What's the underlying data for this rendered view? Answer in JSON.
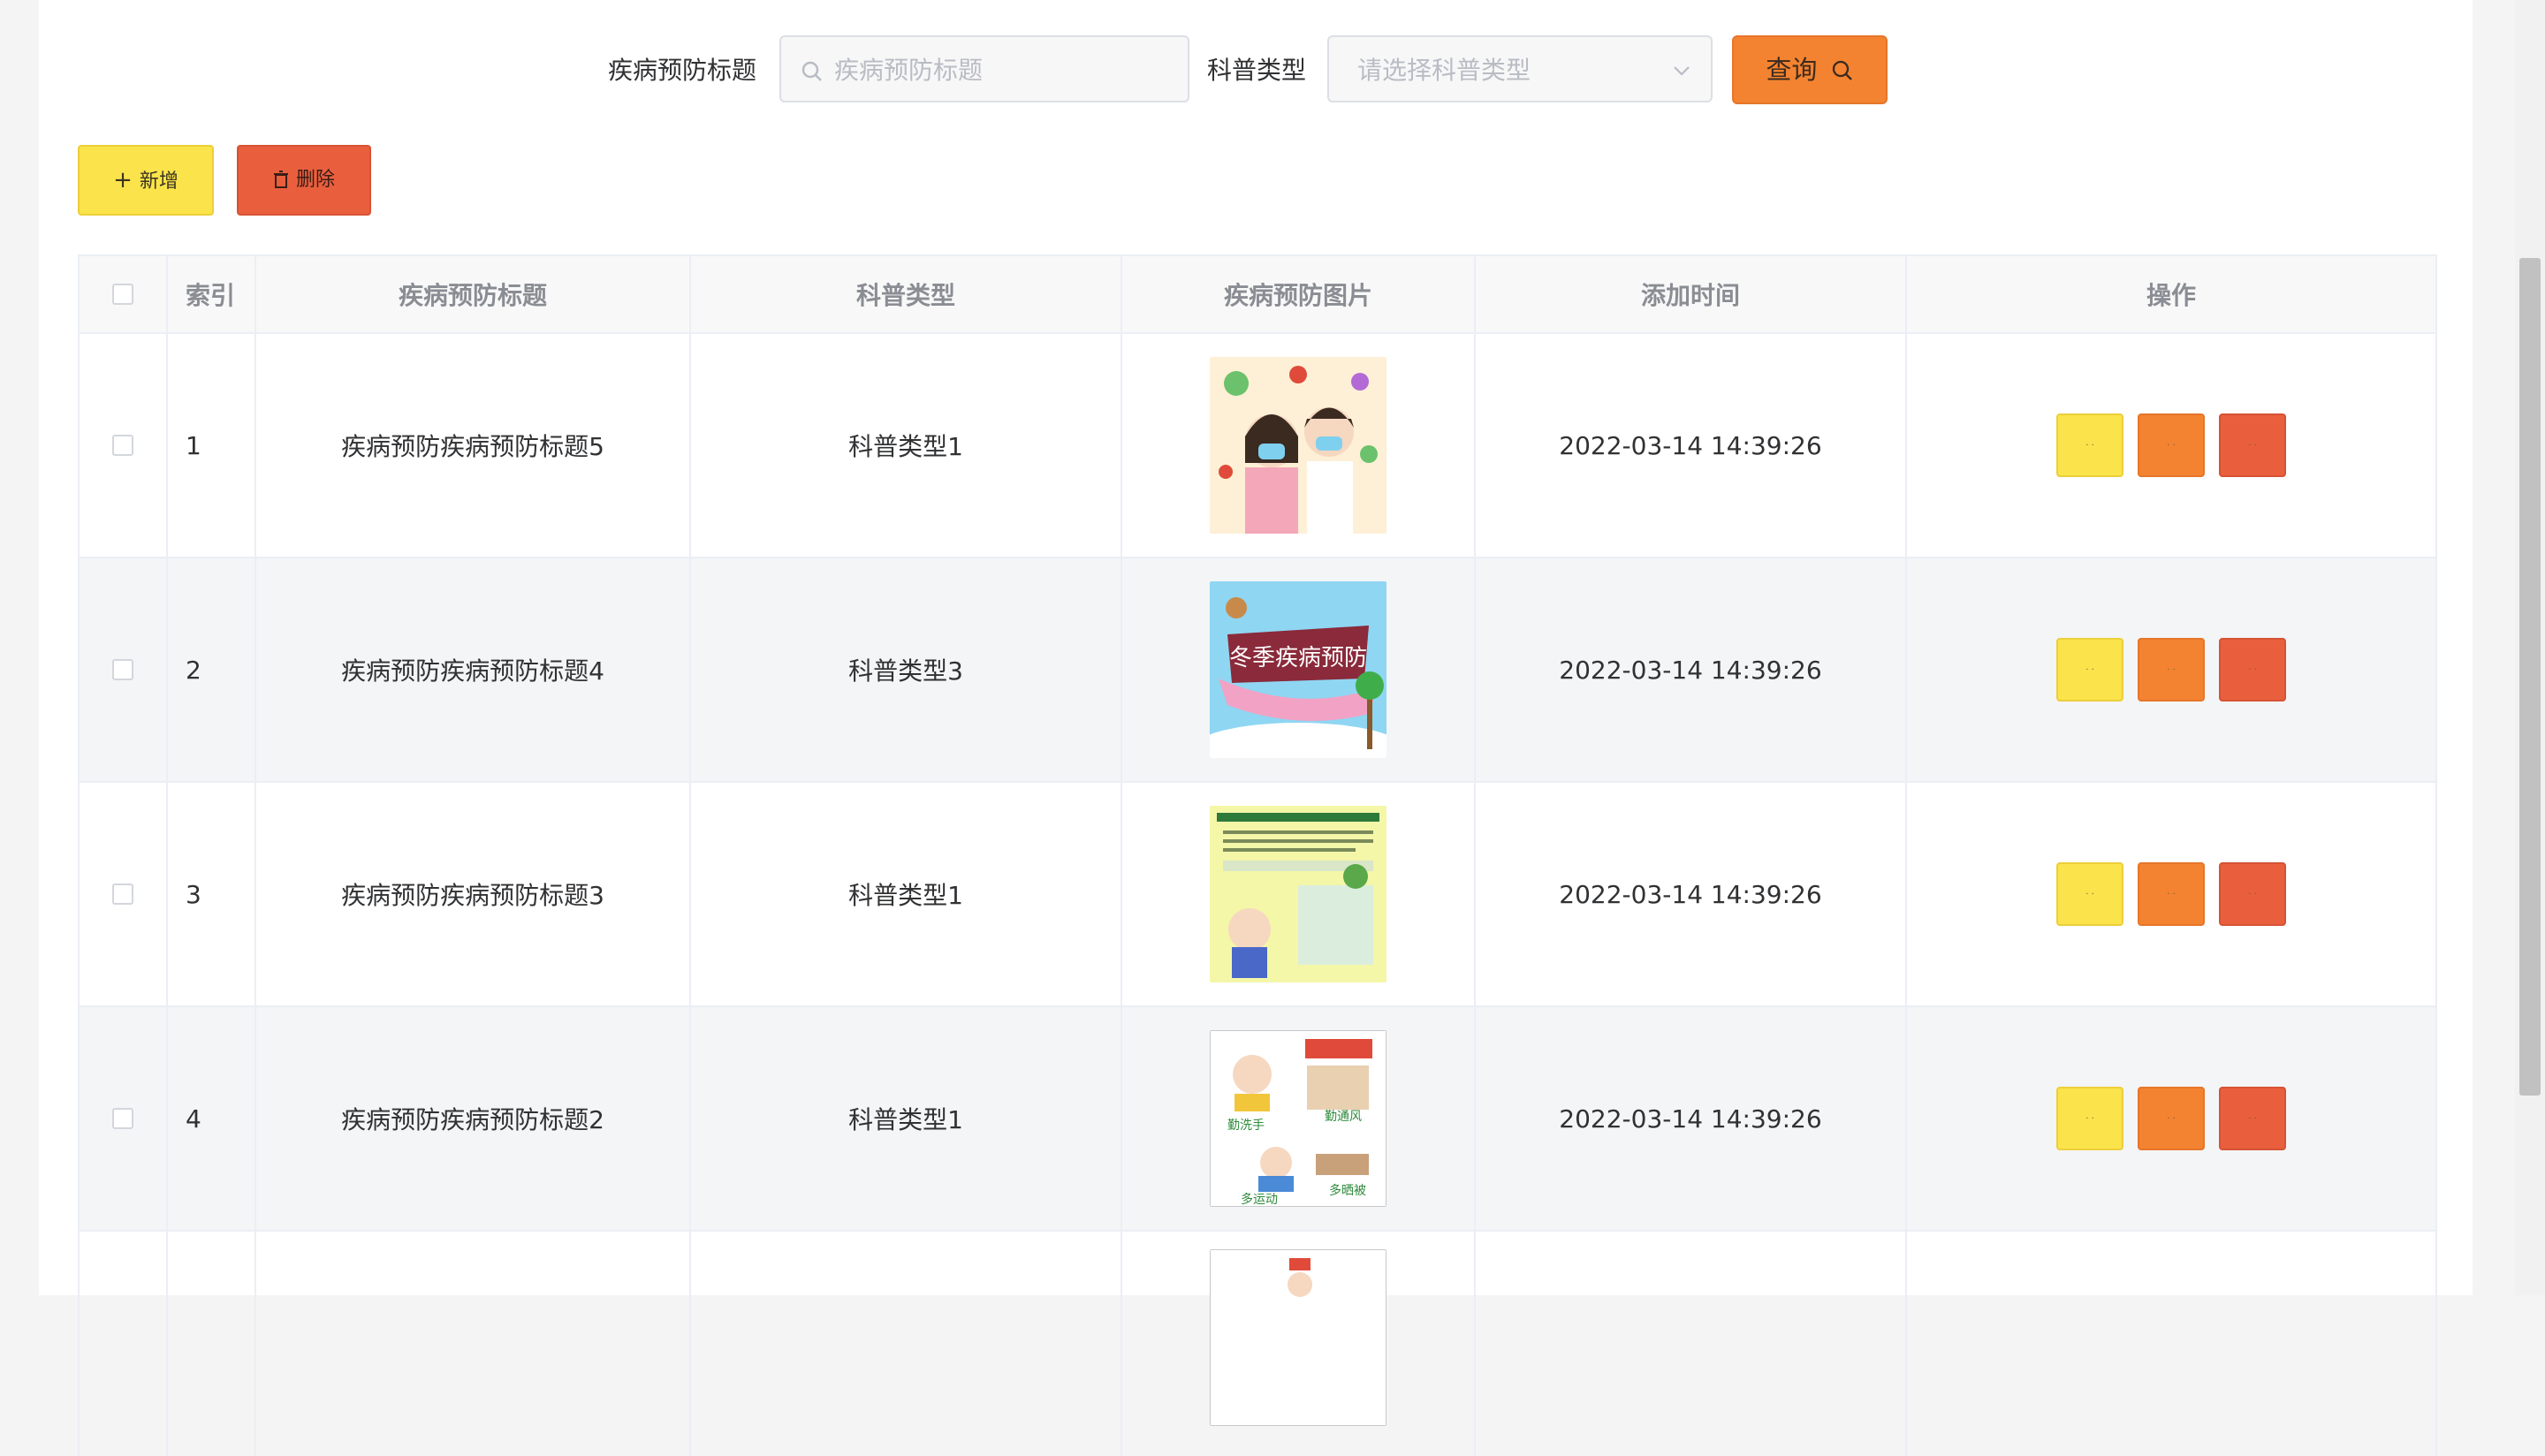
{
  "search": {
    "title_label": "疾病预防标题",
    "title_placeholder": "疾病预防标题",
    "type_label": "科普类型",
    "type_placeholder": "请选择科普类型",
    "query_label": "查询"
  },
  "toolbar": {
    "add_label": "新增",
    "delete_label": "删除"
  },
  "table": {
    "headers": [
      "索引",
      "疾病预防标题",
      "科普类型",
      "疾病预防图片",
      "添加时间",
      "操作"
    ],
    "rows": [
      {
        "index": "1",
        "title": "疾病预防疾病预防标题5",
        "type": "科普类型1",
        "time": "2022-03-14 14:39:26"
      },
      {
        "index": "2",
        "title": "疾病预防疾病预防标题4",
        "type": "科普类型3",
        "time": "2022-03-14 14:39:26",
        "image_text": "冬季疾病预防"
      },
      {
        "index": "3",
        "title": "疾病预防疾病预防标题3",
        "type": "科普类型1",
        "time": "2022-03-14 14:39:26"
      },
      {
        "index": "4",
        "title": "疾病预防疾病预防标题2",
        "type": "科普类型1",
        "time": "2022-03-14 14:39:26",
        "image_text_1": "勤洗手",
        "image_text_2": "勤通风",
        "image_text_3": "多运动",
        "image_text_4": "多晒被"
      }
    ],
    "op_placeholder": "· ·"
  },
  "colors": {
    "yellow": "#fbe34b",
    "orange": "#f38330",
    "red": "#e95f3e"
  }
}
